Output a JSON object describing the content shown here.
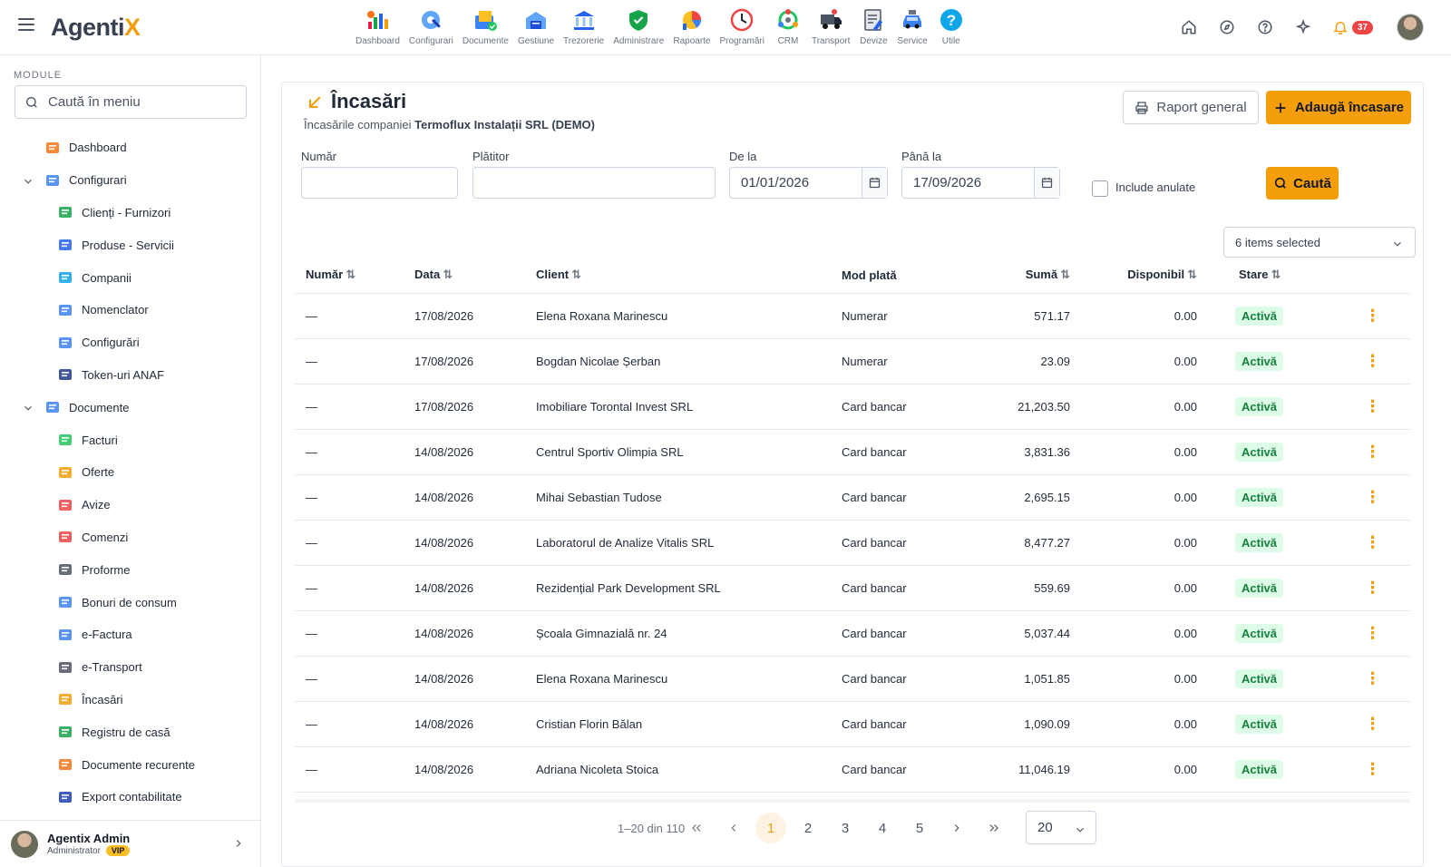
{
  "app": {
    "name_main": "Agenti",
    "name_accent": "X"
  },
  "modules": [
    {
      "label": "Dashboard",
      "icon": "dashboard-icon"
    },
    {
      "label": "Configurari",
      "icon": "configurari-icon"
    },
    {
      "label": "Documente",
      "icon": "documente-icon"
    },
    {
      "label": "Gestiune",
      "icon": "gestiune-icon"
    },
    {
      "label": "Trezorerie",
      "icon": "trezorerie-icon"
    },
    {
      "label": "Administrare",
      "icon": "administrare-icon"
    },
    {
      "label": "Rapoarte",
      "icon": "rapoarte-icon"
    },
    {
      "label": "Programări",
      "icon": "programari-icon"
    },
    {
      "label": "CRM",
      "icon": "crm-icon"
    },
    {
      "label": "Transport",
      "icon": "transport-icon"
    },
    {
      "label": "Devize",
      "icon": "devize-icon"
    },
    {
      "label": "Service",
      "icon": "service-icon"
    },
    {
      "label": "Utile",
      "icon": "utile-icon"
    }
  ],
  "topbar": {
    "notifications": "37"
  },
  "sidebar": {
    "header": "MODULE",
    "search_placeholder": "Caută în meniu",
    "items": [
      {
        "label": "Dashboard",
        "level": 0
      },
      {
        "label": "Configurari",
        "level": 0,
        "expanded": true
      },
      {
        "label": "Clienți - Furnizori",
        "level": 1
      },
      {
        "label": "Produse - Servicii",
        "level": 1
      },
      {
        "label": "Companii",
        "level": 1
      },
      {
        "label": "Nomenclator",
        "level": 1
      },
      {
        "label": "Configurări",
        "level": 1
      },
      {
        "label": "Token-uri ANAF",
        "level": 1
      },
      {
        "label": "Documente",
        "level": 0,
        "expanded": true
      },
      {
        "label": "Facturi",
        "level": 1
      },
      {
        "label": "Oferte",
        "level": 1
      },
      {
        "label": "Avize",
        "level": 1
      },
      {
        "label": "Comenzi",
        "level": 1
      },
      {
        "label": "Proforme",
        "level": 1
      },
      {
        "label": "Bonuri de consum",
        "level": 1
      },
      {
        "label": "e-Factura",
        "level": 1
      },
      {
        "label": "e-Transport",
        "level": 1
      },
      {
        "label": "Încasări",
        "level": 1
      },
      {
        "label": "Registru de casă",
        "level": 1
      },
      {
        "label": "Documente recurente",
        "level": 1
      },
      {
        "label": "Export contabilitate",
        "level": 1
      }
    ],
    "user": {
      "name": "Agentix Admin",
      "role": "Administrator",
      "badge": "VIP"
    }
  },
  "page": {
    "title": "Încasări",
    "subtitle_prefix": "Încasările companiei ",
    "subtitle_company": "Termoflux Instalații SRL (DEMO)",
    "report_button": "Raport general",
    "add_button": "Adaugă încasare"
  },
  "filters": {
    "number_label": "Număr",
    "number_value": "",
    "payer_label": "Plătitor",
    "payer_value": "",
    "from_label": "De la",
    "from_value": "01/01/2026",
    "to_label": "Până la",
    "to_value": "17/09/2026",
    "include_cancelled_label": "Include anulate",
    "search_button": "Caută",
    "status_multiselect": "6 items selected"
  },
  "table": {
    "columns": [
      "Număr",
      "Data",
      "Client",
      "Mod plată",
      "Sumă",
      "Disponibil",
      "Stare"
    ],
    "rows": [
      {
        "numar": "—",
        "data": "17/08/2026",
        "client": "Elena Roxana Marinescu",
        "mod": "Numerar",
        "suma": "571.17",
        "disponibil": "0.00",
        "stare": "Activă"
      },
      {
        "numar": "—",
        "data": "17/08/2026",
        "client": "Bogdan Nicolae Șerban",
        "mod": "Numerar",
        "suma": "23.09",
        "disponibil": "0.00",
        "stare": "Activă"
      },
      {
        "numar": "—",
        "data": "17/08/2026",
        "client": "Imobiliare Torontal Invest SRL",
        "mod": "Card bancar",
        "suma": "21,203.50",
        "disponibil": "0.00",
        "stare": "Activă"
      },
      {
        "numar": "—",
        "data": "14/08/2026",
        "client": "Centrul Sportiv Olimpia SRL",
        "mod": "Card bancar",
        "suma": "3,831.36",
        "disponibil": "0.00",
        "stare": "Activă"
      },
      {
        "numar": "—",
        "data": "14/08/2026",
        "client": "Mihai Sebastian Tudose",
        "mod": "Card bancar",
        "suma": "2,695.15",
        "disponibil": "0.00",
        "stare": "Activă"
      },
      {
        "numar": "—",
        "data": "14/08/2026",
        "client": "Laboratorul de Analize Vitalis SRL",
        "mod": "Card bancar",
        "suma": "8,477.27",
        "disponibil": "0.00",
        "stare": "Activă"
      },
      {
        "numar": "—",
        "data": "14/08/2026",
        "client": "Rezidențial Park Development SRL",
        "mod": "Card bancar",
        "suma": "559.69",
        "disponibil": "0.00",
        "stare": "Activă"
      },
      {
        "numar": "—",
        "data": "14/08/2026",
        "client": "Școala Gimnazială nr. 24",
        "mod": "Card bancar",
        "suma": "5,037.44",
        "disponibil": "0.00",
        "stare": "Activă"
      },
      {
        "numar": "—",
        "data": "14/08/2026",
        "client": "Elena Roxana Marinescu",
        "mod": "Card bancar",
        "suma": "1,051.85",
        "disponibil": "0.00",
        "stare": "Activă"
      },
      {
        "numar": "—",
        "data": "14/08/2026",
        "client": "Cristian Florin Bălan",
        "mod": "Card bancar",
        "suma": "1,090.09",
        "disponibil": "0.00",
        "stare": "Activă"
      },
      {
        "numar": "—",
        "data": "14/08/2026",
        "client": "Adriana Nicoleta Stoica",
        "mod": "Card bancar",
        "suma": "11,046.19",
        "disponibil": "0.00",
        "stare": "Activă"
      }
    ]
  },
  "pagination": {
    "info": "1–20 din 110",
    "pages": [
      "1",
      "2",
      "3",
      "4",
      "5"
    ],
    "current": "1",
    "page_size": "20"
  },
  "colors": {
    "accent": "#f59e0b",
    "active_status_bg": "#dcfce7",
    "active_status_text": "#15803d",
    "badge": "#ef4444"
  }
}
